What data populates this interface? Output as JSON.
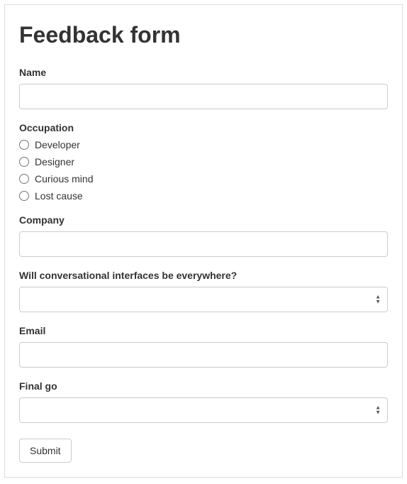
{
  "title": "Feedback form",
  "fields": {
    "name": {
      "label": "Name",
      "value": ""
    },
    "occupation": {
      "label": "Occupation",
      "options": [
        "Developer",
        "Designer",
        "Curious mind",
        "Lost cause"
      ],
      "value": ""
    },
    "company": {
      "label": "Company",
      "value": ""
    },
    "question": {
      "label": "Will conversational interfaces be everywhere?",
      "value": ""
    },
    "email": {
      "label": "Email",
      "value": ""
    },
    "finalgo": {
      "label": "Final go",
      "value": ""
    }
  },
  "submit_label": "Submit"
}
